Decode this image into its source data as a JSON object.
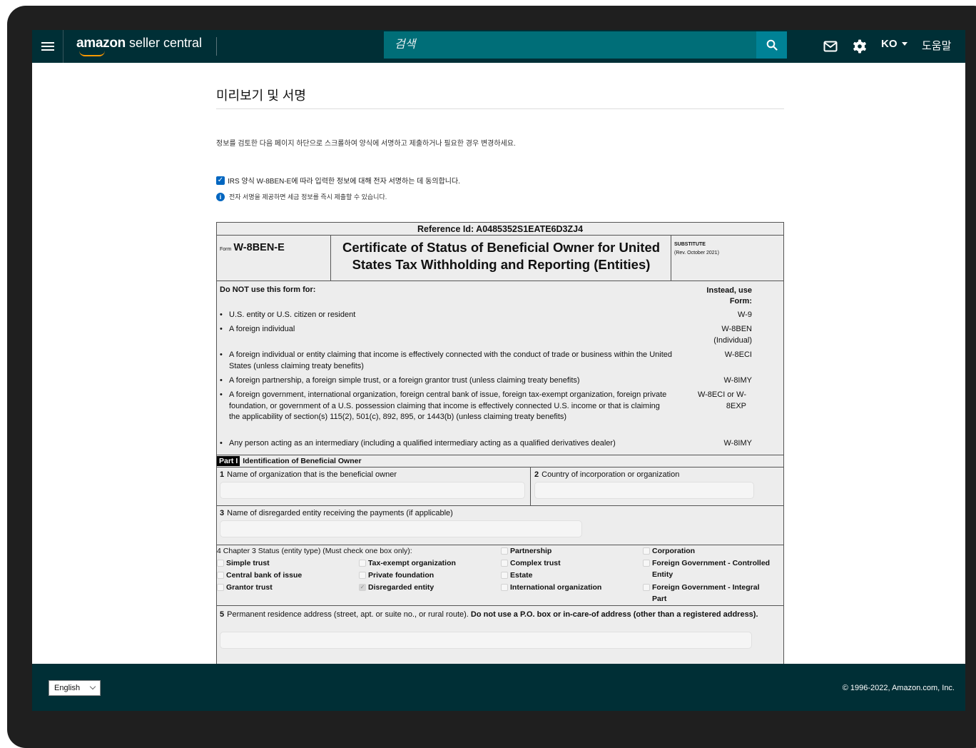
{
  "header": {
    "brand": "amazon",
    "product": "seller central",
    "search_placeholder": "검색",
    "language": "KO",
    "help_label": "도움말",
    "icons": [
      "menu-icon",
      "search-icon",
      "mail-icon",
      "gear-icon"
    ]
  },
  "page": {
    "title": "미리보기 및 서명",
    "instructions": "정보를 검토한 다음 페이지 하단으로 스크롤하여 양식에 서명하고 제출하거나 필요한 경우 변경하세요.",
    "consent_label": "IRS 양식 W-8BEN-E에 따라 입력한 정보에 대해 전자 서명하는 데 동의합니다.",
    "consent_checked": true,
    "info_text": "전자 서명을 제공하면 세금 정보를 즉시 제출할 수 있습니다."
  },
  "form": {
    "reference": "Reference Id: A0485352S1EATE6D3ZJ4",
    "form_prefix": "Form",
    "form_name": "W-8BEN-E",
    "title": "Certificate of Status of Beneficial Owner for United States Tax Withholding and Reporting (Entities)",
    "substitute": "SUBSTITUTE",
    "revision": "(Rev. October 2021)",
    "do_not_use": "Do NOT use this form for:",
    "instead_use": "Instead, use Form:",
    "rows": [
      {
        "text": "U.S. entity or U.S. citizen or resident",
        "form": "W-9"
      },
      {
        "text": "A foreign individual",
        "form": "W-8BEN (Individual)"
      },
      {
        "text": "A foreign individual or entity claiming that income is effectively connected with the conduct of trade or business within the United States (unless claiming treaty benefits)",
        "form": "W-8ECI"
      },
      {
        "text": "A foreign partnership, a foreign simple trust, or a foreign grantor trust (unless claiming treaty benefits)",
        "form": "W-8IMY"
      },
      {
        "text": "A foreign government, international organization, foreign central bank of issue, foreign tax-exempt organization, foreign private foundation, or government of a U.S. possession claiming that income is effectively connected U.S. income or that is claiming the applicability of section(s) 115(2), 501(c), 892, 895, or 1443(b) (unless claiming treaty benefits)",
        "form": "W-8ECI or W-8EXP"
      },
      {
        "text": "Any person acting as an intermediary (including a qualified intermediary acting as a qualified derivatives dealer)",
        "form": "W-8IMY"
      }
    ],
    "part_tag": "Part I",
    "part_title": "Identification of Beneficial Owner",
    "line1_num": "1",
    "line1_label": "Name of organization that is the beneficial owner",
    "line2_num": "2",
    "line2_label": "Country of incorporation or organization",
    "line3_num": "3",
    "line3_label": "Name of disregarded entity receiving the payments (if applicable)",
    "line4_num": "4",
    "line4_label": "Chapter 3 Status (entity type) (Must check one box only):",
    "status_options": {
      "partnership": "Partnership",
      "corporation": "Corporation",
      "simple_trust": "Simple trust",
      "tax_exempt": "Tax-exempt organization",
      "complex_trust": "Complex trust",
      "foreign_gov_controlled": "Foreign Government - Controlled Entity",
      "central_bank": "Central bank of issue",
      "private_foundation": "Private foundation",
      "estate": "Estate",
      "grantor_trust": "Grantor trust",
      "disregarded_entity": "Disregarded entity",
      "international_org": "International organization",
      "foreign_gov_integral": "Foreign Government - Integral Part"
    },
    "selected_status": "Disregarded entity",
    "line5_num": "5",
    "line5_label": "Permanent residence address (street, apt. or suite no., or rural route).",
    "line5_bold": "Do not use a P.O. box or in-care-of address (other than a registered address)."
  },
  "footer": {
    "language": "English",
    "copyright": "© 1996-2022, Amazon.com, Inc."
  }
}
